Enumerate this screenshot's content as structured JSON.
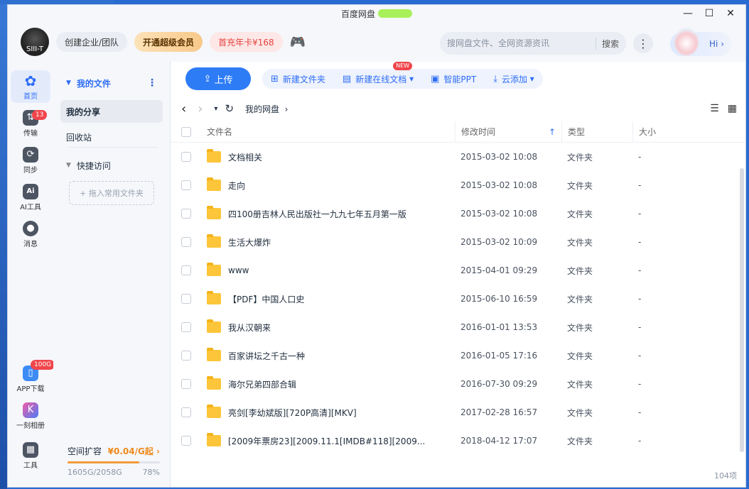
{
  "window": {
    "title": "百度网盘"
  },
  "header": {
    "avatar_text": "SIII-T",
    "create_team": "创建企业/团队",
    "vip": "开通超级会员",
    "promo": "首充年卡¥168",
    "search_placeholder": "搜网盘文件、全网资源资讯",
    "search_button": "搜索",
    "hi": "Hi"
  },
  "leftnav": {
    "items": [
      {
        "label": "首页"
      },
      {
        "label": "传输",
        "badge": "13"
      },
      {
        "label": "同步"
      },
      {
        "label": "AI工具"
      },
      {
        "label": "消息"
      },
      {
        "label": "APP下载",
        "badge": "100G"
      },
      {
        "label": "一刻相册"
      },
      {
        "label": "工具"
      }
    ]
  },
  "sidebar": {
    "my_files": "我的文件",
    "my_share": "我的分享",
    "recycle": "回收站",
    "quick_access": "快捷访问",
    "drop_hint": "+ 拖入常用文件夹",
    "storage_title": "空间扩容",
    "storage_price": "¥0.04/G起",
    "storage_used": "1605G/2058G",
    "storage_percent": "78%",
    "storage_fraction": 0.78
  },
  "toolbar": {
    "upload": "上传",
    "new_folder": "新建文件夹",
    "new_doc": "新建在线文档",
    "new_tag": "NEW",
    "smart_ppt": "智能PPT",
    "cloud_add": "云添加"
  },
  "path": {
    "root": "我的网盘"
  },
  "table": {
    "headers": {
      "name": "文件名",
      "time": "修改时间",
      "type": "类型",
      "size": "大小"
    },
    "rows": [
      {
        "name": "文档相关",
        "time": "2015-03-02 10:08",
        "type": "文件夹",
        "size": "-"
      },
      {
        "name": "走向",
        "time": "2015-03-02 10:08",
        "type": "文件夹",
        "size": "-"
      },
      {
        "name": "四100册吉林人民出版社一九九七年五月第一版",
        "time": "2015-03-02 10:08",
        "type": "文件夹",
        "size": "-"
      },
      {
        "name": "生活大爆炸",
        "time": "2015-03-02 10:09",
        "type": "文件夹",
        "size": "-"
      },
      {
        "name": "www",
        "time": "2015-04-01 09:29",
        "type": "文件夹",
        "size": "-"
      },
      {
        "name": "【PDF】中国人口史",
        "time": "2015-06-10 16:59",
        "type": "文件夹",
        "size": "-"
      },
      {
        "name": "我从汉朝来",
        "time": "2016-01-01 13:53",
        "type": "文件夹",
        "size": "-"
      },
      {
        "name": "百家讲坛之千古一种",
        "time": "2016-01-05 17:16",
        "type": "文件夹",
        "size": "-"
      },
      {
        "name": "海尔兄弟四部合辑",
        "time": "2016-07-30 09:29",
        "type": "文件夹",
        "size": "-"
      },
      {
        "name": "亮剑[李幼斌版][720P高清][MKV]",
        "time": "2017-02-28 16:57",
        "type": "文件夹",
        "size": "-"
      },
      {
        "name": "[2009年票房23][2009.11.1[IMDB#118][2009...",
        "time": "2018-04-12 17:07",
        "type": "文件夹",
        "size": "-"
      }
    ]
  },
  "footer": {
    "count": "104项"
  }
}
